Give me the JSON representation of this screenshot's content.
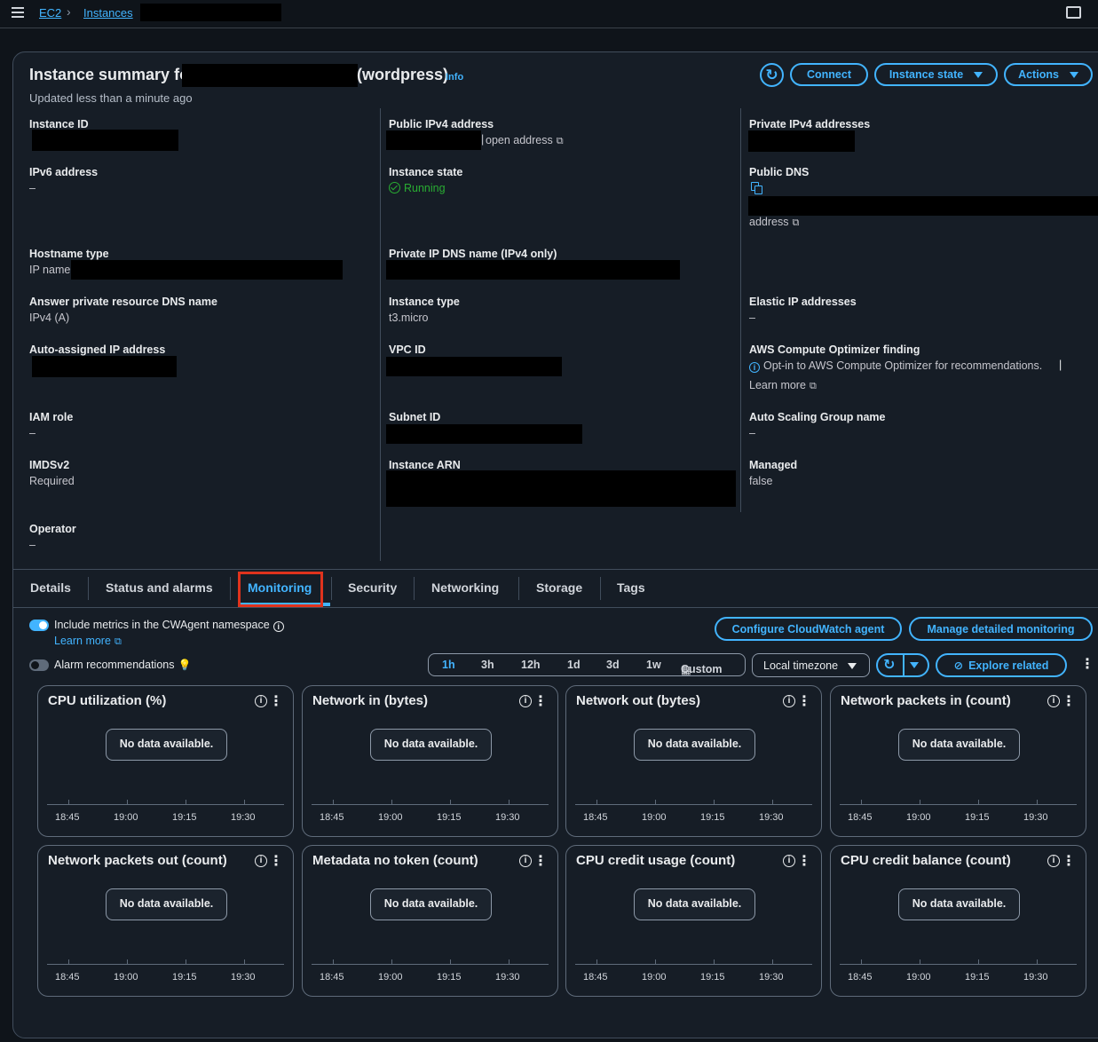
{
  "breadcrumb": {
    "ec2": "EC2",
    "instances": "Instances"
  },
  "summary": {
    "title_prefix": "Instance summary fo",
    "title_suffix": "(wordpress)",
    "info": "Info",
    "updated": "Updated less than a minute ago",
    "buttons": {
      "connect": "Connect",
      "instance_state": "Instance state",
      "actions": "Actions"
    }
  },
  "details": {
    "instance_id_label": "Instance ID",
    "ipv6_label": "IPv6 address",
    "ipv6_value": "–",
    "hostname_type_label": "Hostname type",
    "hostname_type_value": "IP name",
    "answer_dns_label": "Answer private resource DNS name",
    "answer_dns_value": "IPv4 (A)",
    "auto_ip_label": "Auto-assigned IP address",
    "iam_label": "IAM role",
    "iam_value": "–",
    "imds_label": "IMDSv2",
    "imds_value": "Required",
    "operator_label": "Operator",
    "operator_value": "–",
    "public_ipv4_label": "Public IPv4 address",
    "open_address": "open address",
    "instance_state_label": "Instance state",
    "instance_state_value": "Running",
    "private_dns_label": "Private IP DNS name (IPv4 only)",
    "instance_type_label": "Instance type",
    "instance_type_value": "t3.micro",
    "vpc_label": "VPC ID",
    "subnet_label": "Subnet ID",
    "arn_label": "Instance ARN",
    "private_ipv4_label": "Private IPv4 addresses",
    "public_dns_label": "Public DNS",
    "public_dns_link": "address",
    "elastic_label": "Elastic IP addresses",
    "elastic_value": "–",
    "optimizer_label": "AWS Compute Optimizer finding",
    "optimizer_link": "Opt-in to AWS Compute Optimizer for recommendations.",
    "learn_more": "Learn more",
    "asg_label": "Auto Scaling Group name",
    "asg_value": "–",
    "managed_label": "Managed",
    "managed_value": "false"
  },
  "tabs": [
    "Details",
    "Status and alarms",
    "Monitoring",
    "Security",
    "Networking",
    "Storage",
    "Tags"
  ],
  "monitoring": {
    "include_metrics": "Include metrics in the CWAgent namespace",
    "learn_more": "Learn more",
    "alarm_recs": "Alarm recommendations",
    "configure_agent": "Configure CloudWatch agent",
    "manage_monitoring": "Manage detailed monitoring",
    "ranges": [
      "1h",
      "3h",
      "12h",
      "1d",
      "3d",
      "1w"
    ],
    "custom": "Custom",
    "timezone": "Local timezone",
    "explore": "Explore related",
    "no_data": "No data available.",
    "times": [
      "18:45",
      "19:00",
      "19:15",
      "19:30"
    ],
    "widgets": [
      "CPU utilization (%)",
      "Network in (bytes)",
      "Network out (bytes)",
      "Network packets in (count)",
      "Network packets out (count)",
      "Metadata no token (count)",
      "CPU credit usage (count)",
      "CPU credit balance (count)"
    ]
  }
}
